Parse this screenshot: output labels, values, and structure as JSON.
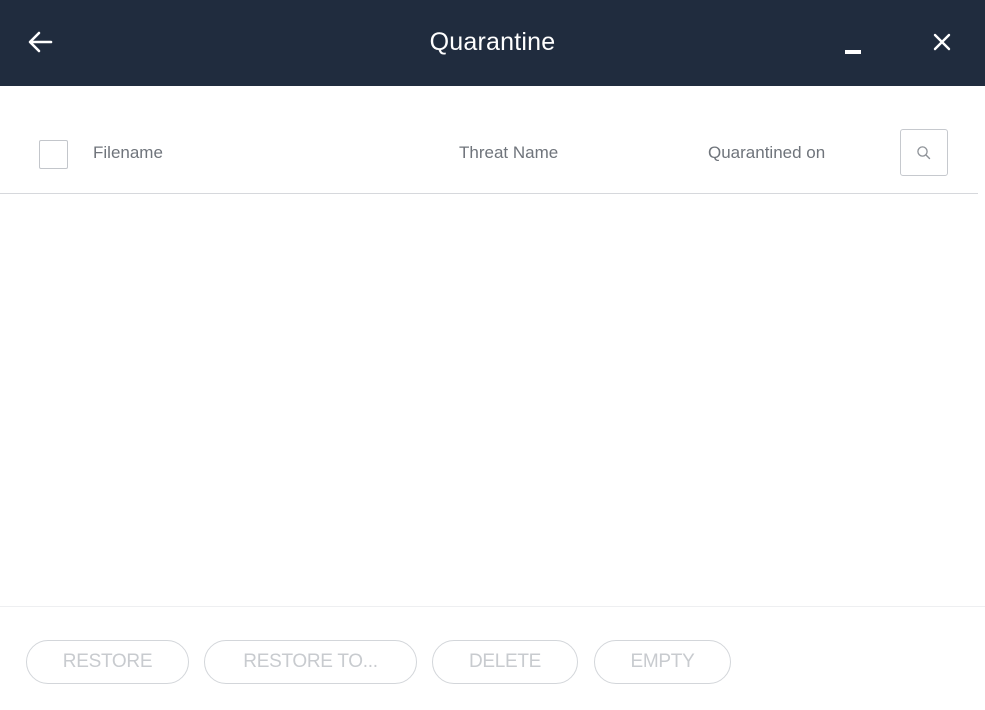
{
  "window": {
    "title": "Quarantine",
    "back_icon": "arrow-left-icon",
    "minimize_icon": "minimize-icon",
    "close_icon": "close-icon"
  },
  "table": {
    "columns": {
      "filename": "Filename",
      "threat_name": "Threat Name",
      "quarantined_on": "Quarantined on"
    },
    "select_all_checked": false,
    "search_icon": "search-icon",
    "rows": []
  },
  "actions": {
    "restore": "RESTORE",
    "restore_to": "RESTORE TO...",
    "delete": "DELETE",
    "empty": "EMPTY"
  },
  "colors": {
    "titlebar_bg": "#202c3e",
    "header_text": "#6f747b",
    "disabled_button_text": "#c8cbcf"
  }
}
